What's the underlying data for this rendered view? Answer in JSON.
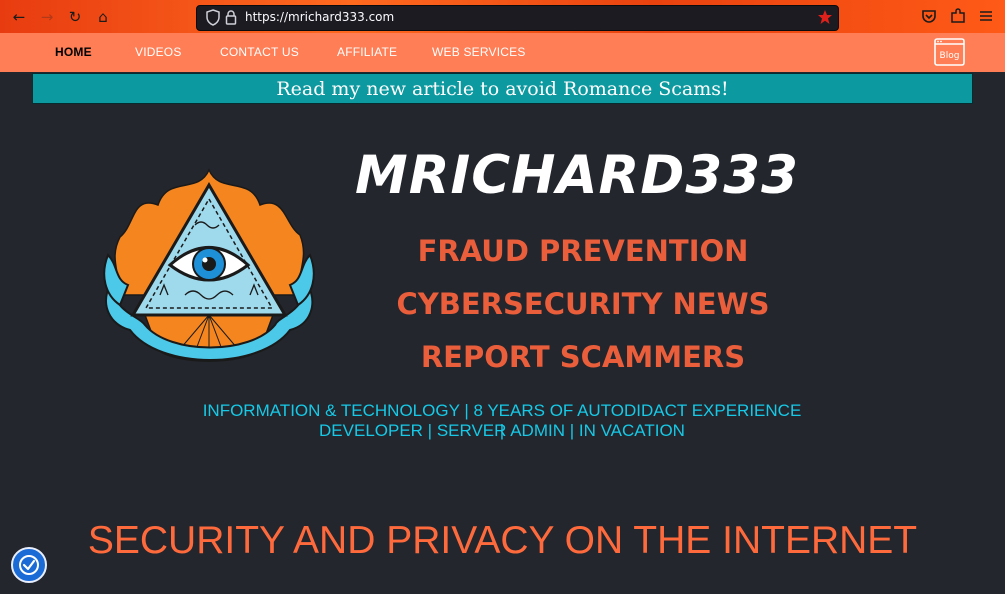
{
  "browser": {
    "url": "https://mrichard333.com",
    "icons": [
      "back-icon",
      "forward-icon",
      "reload-icon",
      "home-icon",
      "shield-icon",
      "lock-icon",
      "bookmark-star-icon",
      "pocket-icon",
      "extensions-icon",
      "menu-icon"
    ]
  },
  "nav": {
    "items": [
      {
        "label": "HOME"
      },
      {
        "label": "VIDEOS"
      },
      {
        "label": "CONTACT US"
      },
      {
        "label": "AFFILIATE"
      },
      {
        "label": "WEB SERVICES"
      }
    ],
    "blog_icon_text": "Blog"
  },
  "banner": {
    "text": "Read my new article to avoid Romance Scams!"
  },
  "hero": {
    "title": "MRICHARD333",
    "services": [
      "FRAUD PREVENTION",
      "CYBERSECURITY NEWS",
      "REPORT SCAMMERS"
    ],
    "info_lines": [
      "INFORMATION & TECHNOLOGY | 8 YEARS OF AUTODIDACT EXPERIENCE |",
      "DEVELOPER | SERVER ADMIN | IN VACATION"
    ]
  },
  "headline": "SECURITY AND PRIVACY ON THE INTERNET",
  "colors": {
    "nav_bg": "#ff7e55",
    "banner_bg": "#0c9aa0",
    "page_bg": "#23262d",
    "service_text": "#ea5e3b",
    "info_text": "#16c9e6",
    "headline_text": "#ff6a3d"
  }
}
